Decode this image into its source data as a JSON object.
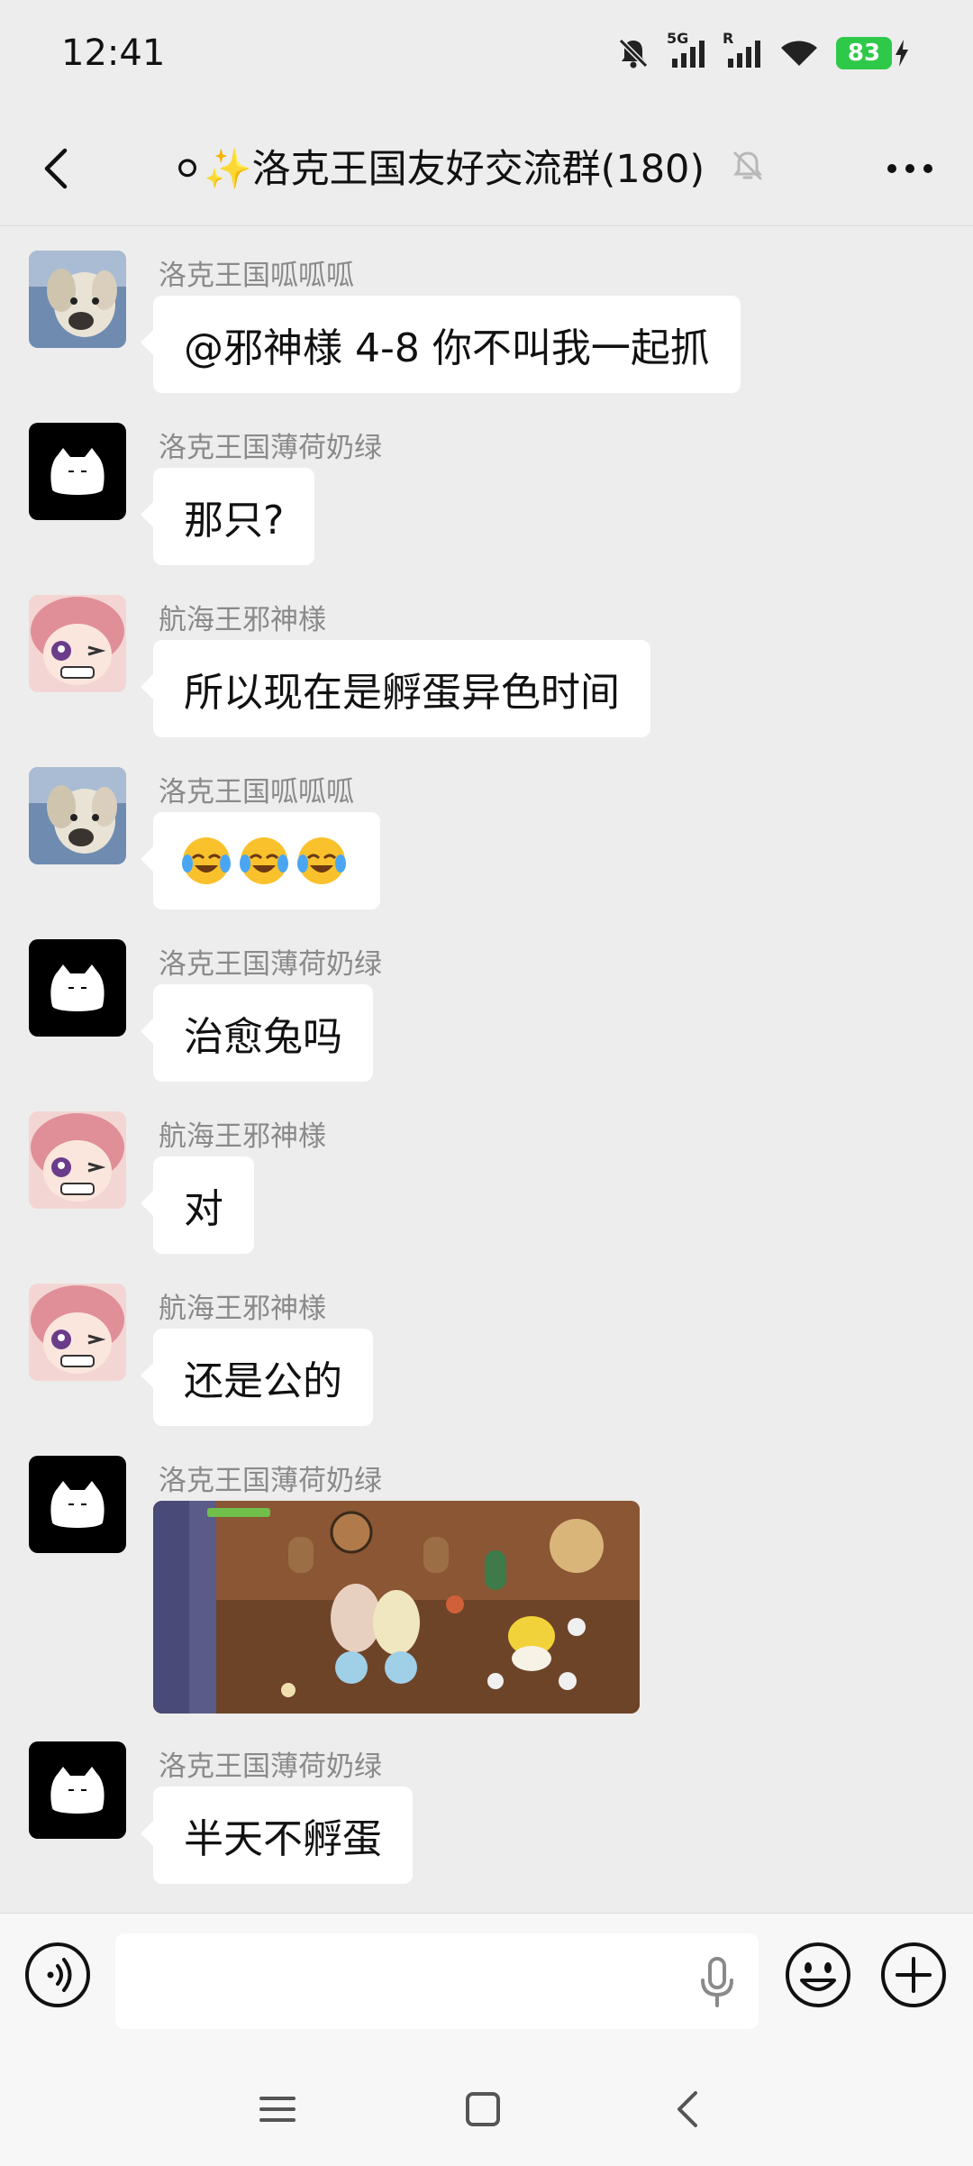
{
  "status_bar": {
    "time": "12:41",
    "network_label": "5G",
    "roaming_label": "R",
    "battery_level": "83"
  },
  "header": {
    "title": "⚪✨洛克王国友好交流群(180)",
    "back_icon": "chevron-left-icon",
    "muted_icon": "bell-off-icon",
    "more_icon": "more-dots-icon"
  },
  "messages": [
    {
      "sender": "洛克王国呱呱呱",
      "type": "text",
      "text": "@邪神様 4-8 你不叫我一起抓",
      "avatar": "dog-photo"
    },
    {
      "sender": "洛克王国薄荷奶绿",
      "type": "text",
      "text": "那只?",
      "avatar": "white-cat-blob"
    },
    {
      "sender": "航海王邪神様",
      "type": "text",
      "text": "所以现在是孵蛋异色时间",
      "avatar": "anime-girl-pink"
    },
    {
      "sender": "洛克王国呱呱呱",
      "type": "text",
      "text": "😭😭😭",
      "avatar": "dog-photo"
    },
    {
      "sender": "洛克王国薄荷奶绿",
      "type": "text",
      "text": "治愈兔吗",
      "avatar": "white-cat-blob"
    },
    {
      "sender": "航海王邪神様",
      "type": "text",
      "text": "对",
      "avatar": "anime-girl-pink"
    },
    {
      "sender": "航海王邪神様",
      "type": "text",
      "text": "还是公的",
      "avatar": "anime-girl-pink"
    },
    {
      "sender": "洛克王国薄荷奶绿",
      "type": "image",
      "text": "",
      "avatar": "white-cat-blob"
    },
    {
      "sender": "洛克王国薄荷奶绿",
      "type": "text",
      "text": "半天不孵蛋",
      "avatar": "white-cat-blob"
    }
  ],
  "input_bar": {
    "value": "",
    "voice_icon": "voice-mode-icon",
    "mic_icon": "microphone-icon",
    "emoji_icon": "smiley-icon",
    "plus_icon": "plus-circle-icon"
  },
  "colors": {
    "background": "#ededed",
    "bubble": "#ffffff",
    "sender_text": "#8a8a8a",
    "battery": "#2fc94a"
  }
}
